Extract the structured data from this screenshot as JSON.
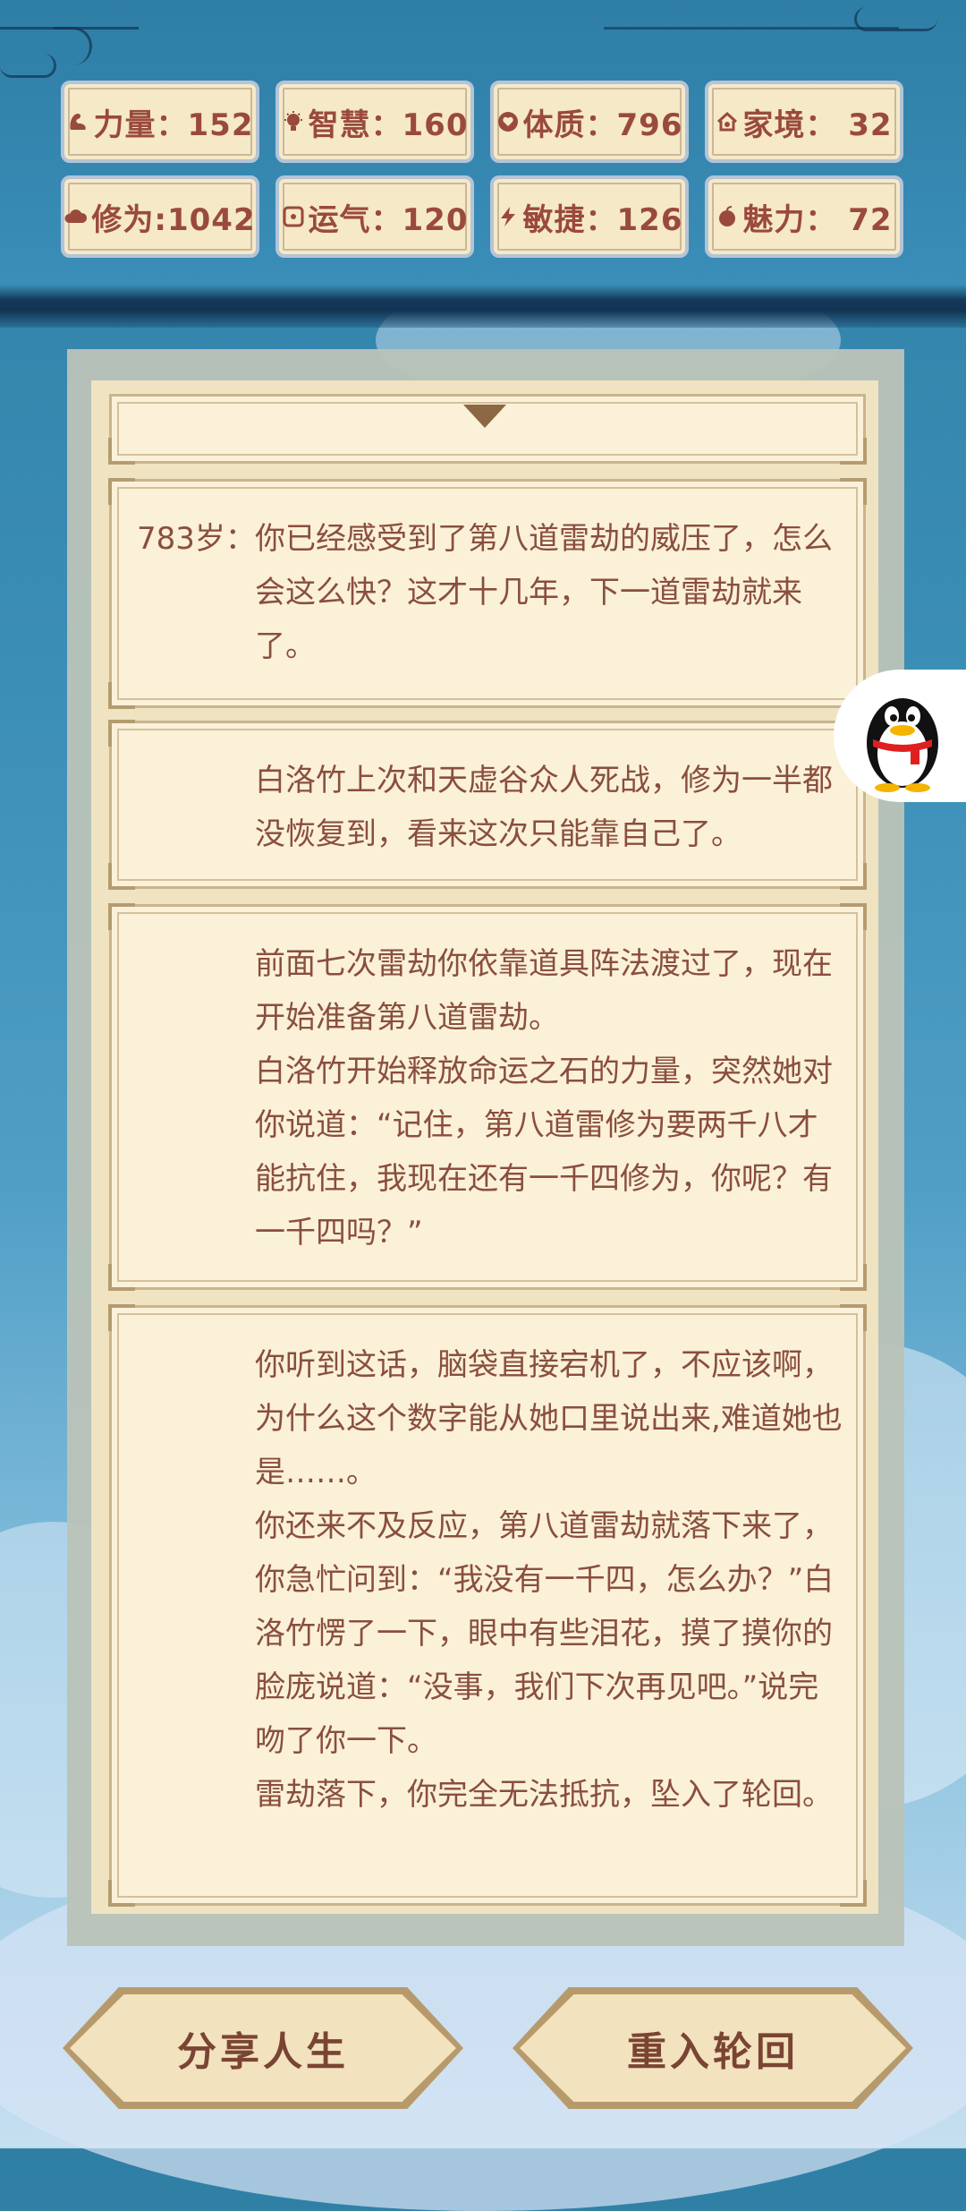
{
  "stats": [
    {
      "icon": "muscle-icon",
      "label": "力量：152"
    },
    {
      "icon": "bulb-icon",
      "label": "智慧：160"
    },
    {
      "icon": "heart-circle-icon",
      "label": "体质：796"
    },
    {
      "icon": "home-icon",
      "label": "家境： 32"
    },
    {
      "icon": "cloud-icon",
      "label": "修为:1042"
    },
    {
      "icon": "dice-icon",
      "label": "运气：120"
    },
    {
      "icon": "lightning-icon",
      "label": "敏捷：126"
    },
    {
      "icon": "apple-icon",
      "label": "魅力： 72"
    }
  ],
  "log": {
    "entries": [
      {
        "age": "783岁：",
        "lines": [
          "你已经感受到了第八道雷劫的威压了，怎么会这么快？这才十几年，下一道雷劫就来了。"
        ]
      },
      {
        "age": "",
        "lines": [
          "白洛竹上次和天虚谷众人死战，修为一半都没恢复到，看来这次只能靠自己了。"
        ]
      },
      {
        "age": "",
        "lines": [
          "前面七次雷劫你依靠道具阵法渡过了，现在开始准备第八道雷劫。",
          "白洛竹开始释放命运之石的力量，突然她对你说道：“记住，第八道雷修为要两千八才能抗住，我现在还有一千四修为，你呢？有一千四吗？”"
        ]
      },
      {
        "age": "",
        "lines": [
          "你听到这话，脑袋直接宕机了，不应该啊，为什么这个数字能从她口里说出来,难道她也是……。",
          "你还来不及反应，第八道雷劫就落下来了，你急忙问到：“我没有一千四，怎么办？”白洛竹愣了一下，眼中有些泪花，摸了摸你的脸庞说道：“没事，我们下次再见吧。”说完吻了你一下。",
          "雷劫落下，你完全无法抵抗，坠入了轮回。"
        ]
      }
    ]
  },
  "buttons": {
    "share": "分享人生",
    "restart": "重入轮回"
  },
  "floating": {
    "icon": "qq-penguin-icon"
  },
  "colors": {
    "stat_text": "#9a4a3c",
    "log_text": "#8a4e3e",
    "card_bg": "#faf1d8",
    "button_text": "#7a4434"
  }
}
